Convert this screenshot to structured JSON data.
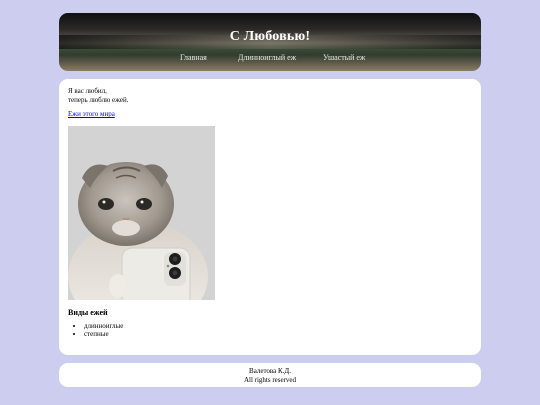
{
  "header": {
    "title": "С Любовью!",
    "nav": [
      {
        "label": "Главная"
      },
      {
        "label": "Длинноиглый еж"
      },
      {
        "label": "Ушастый еж"
      }
    ]
  },
  "main": {
    "poem_line1": "Я вас любил,",
    "poem_line2": "теперь люблю ежей.",
    "link_label": "Ежи этого мира",
    "section_title": "Виды ежей",
    "kinds": [
      "длинноиглые",
      "степные"
    ]
  },
  "footer": {
    "author": "Валетова К.Д.",
    "rights": "All rights reserved"
  },
  "colors": {
    "background": "#cdcdf0",
    "card": "#ffffff",
    "link": "#0000ee"
  }
}
